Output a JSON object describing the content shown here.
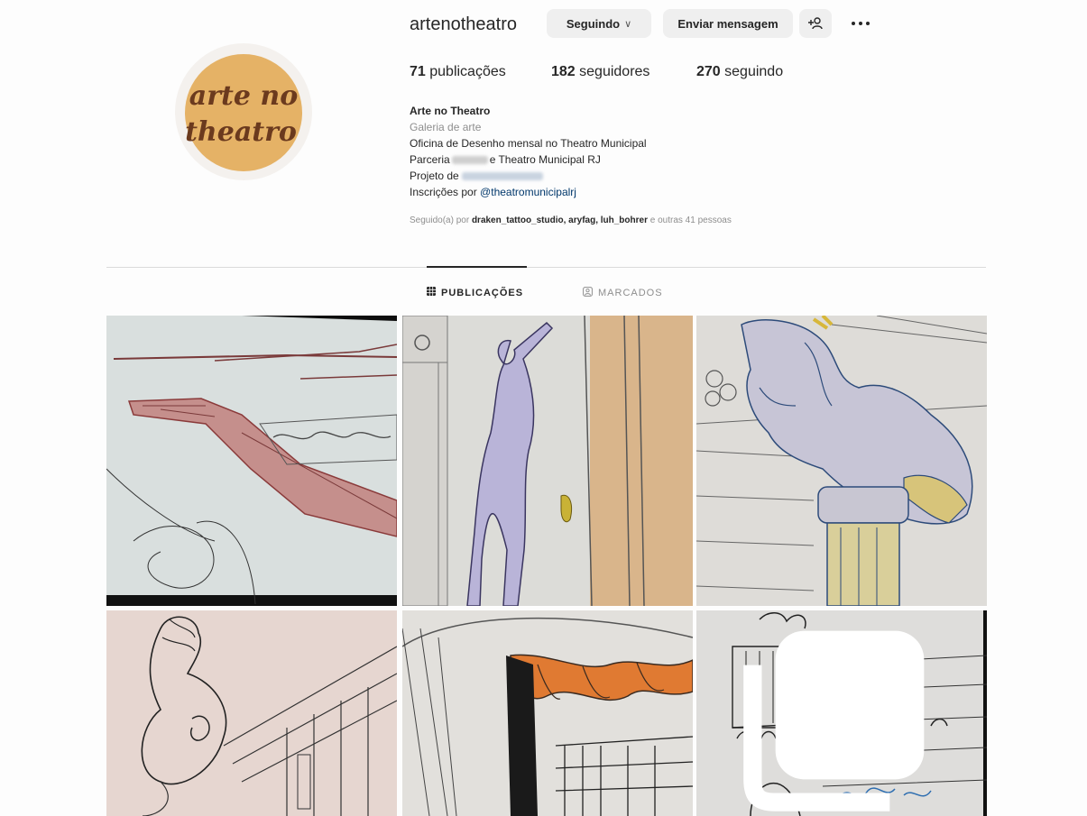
{
  "profile": {
    "username": "artenotheatro",
    "avatar_text": [
      "arte no",
      "theatro"
    ],
    "avatar_bg": "#e5b266",
    "avatar_ink": "#6b3a1e"
  },
  "actions": {
    "following_label": "Seguindo",
    "message_label": "Enviar mensagem",
    "suggest_icon": "add-person-icon",
    "more_icon": "more-options-icon"
  },
  "stats": {
    "posts_count": "71",
    "posts_label": "publicações",
    "followers_count": "182",
    "followers_label": "seguidores",
    "following_count": "270",
    "following_label": "seguindo"
  },
  "bio": {
    "name": "Arte no Theatro",
    "category": "Galeria de arte",
    "line1": "Oficina de Desenho mensal no Theatro Municipal",
    "line2_prefix": "Parceria",
    "line2_suffix": "e Theatro Municipal RJ",
    "line3_prefix": "Projeto de",
    "line4_prefix": "Inscrições por",
    "line4_link": "@theatromunicipalrj"
  },
  "followed_by": {
    "prefix": "Seguido(a) por",
    "users": "draken_tattoo_studio, aryfag, luh_bohrer",
    "suffix": "e outras 41 pessoas"
  },
  "tabs": {
    "posts_label": "PUBLICAÇÕES",
    "tagged_label": "MARCADOS",
    "posts_icon": "grid-icon",
    "tagged_icon": "tagged-icon"
  },
  "posts": [
    {
      "subject": "red-staircase-sketch"
    },
    {
      "subject": "statue-figure-sketch"
    },
    {
      "subject": "column-atlas-sketch"
    },
    {
      "subject": "ornament-volute-sketch"
    },
    {
      "subject": "stage-curtain-sketch"
    },
    {
      "subject": "theatre-balcony-sketch",
      "icon": "multiple-photos-icon"
    }
  ],
  "colors": {
    "accent_link": "#00376b",
    "button_bg": "#efefef",
    "muted_text": "#8e8e8e"
  }
}
